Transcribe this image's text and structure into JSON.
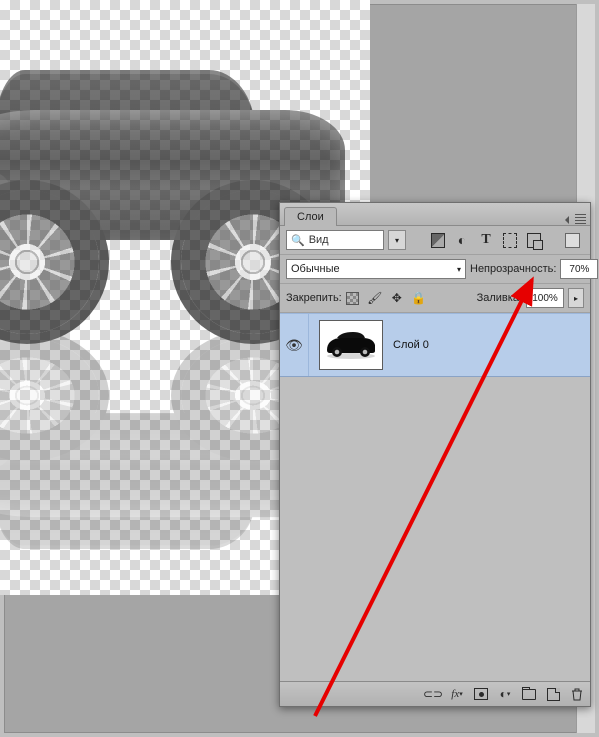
{
  "panel": {
    "title": "Слои",
    "search_label": "Вид",
    "filter_icons": {
      "image": "image-filter-icon",
      "adjust": "adjustment-filter-icon",
      "type": "type-filter-icon",
      "shape": "shape-filter-icon",
      "smart": "smart-object-filter-icon"
    },
    "blend_mode": "Обычные",
    "opacity_label": "Непрозрачность:",
    "opacity_value": "70%",
    "lock_label": "Закрепить:",
    "fill_label": "Заливка:",
    "fill_value": "100%"
  },
  "layers": [
    {
      "name": "Слой 0",
      "visible": true,
      "selected": true
    }
  ],
  "footer_icons": {
    "link": "link-layers-icon",
    "fx": "layer-style-icon",
    "mask": "layer-mask-icon",
    "adjust": "new-adjustment-layer-icon",
    "group": "new-group-icon",
    "new": "new-layer-icon",
    "trash": "delete-layer-icon"
  },
  "annotation": {
    "color": "#e60000",
    "target": "opacity-value-field"
  }
}
